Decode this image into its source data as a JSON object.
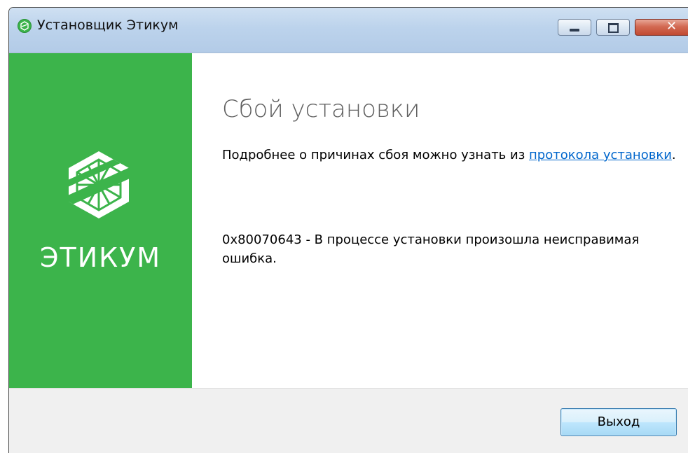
{
  "window": {
    "title": "Установщик Этикум",
    "close_glyph": "✕"
  },
  "sidebar": {
    "logo_text": "ЭТИКУМ",
    "logo_icon": "hexagon-lattice-logo",
    "brand_color": "#3cb44b"
  },
  "main": {
    "heading": "Сбой установки",
    "details_prefix": "Подробнее о причинах сбоя можно узнать из ",
    "log_link": "протокола установки",
    "details_suffix": ".",
    "error_message": "0x80070643 - В процессе установки произошла неисправимая ошибка."
  },
  "footer": {
    "exit_label": "Выход"
  },
  "colors": {
    "link": "#0066cc",
    "heading": "#5f5f5f",
    "titlebar": "#bcd3ec"
  }
}
